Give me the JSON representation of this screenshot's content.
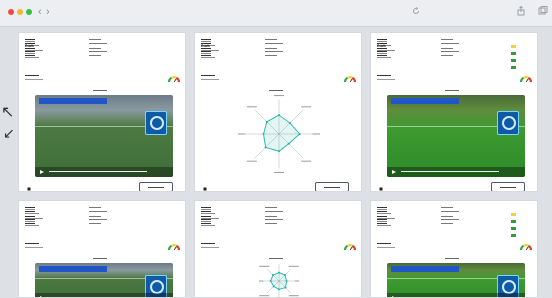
{
  "window": {
    "traffic_lights": [
      "#ef4a3e",
      "#f2b634",
      "#30c244"
    ],
    "nav_back_glyph": "‹",
    "nav_forward_glyph": "›",
    "icons": [
      "refresh-icon",
      "share-icon",
      "new-tab-icon"
    ]
  },
  "annotation": {
    "arrow_up_glyph": "↖",
    "arrow_down_glyph": "↙"
  },
  "cards": [
    {
      "variant": "video",
      "player_name": "Eswik",
      "pitch": "grass-dark",
      "show_player_icon": true
    },
    {
      "variant": "radar",
      "player_name": "Eswik"
    },
    {
      "variant": "video",
      "player_name": "Eswik",
      "pitch": "grass-bright",
      "show_player_icon": true,
      "bars": true
    },
    {
      "variant": "video",
      "player_name": "",
      "pitch": "grass-dark"
    },
    {
      "variant": "radar",
      "player_name": ""
    },
    {
      "variant": "video",
      "player_name": "",
      "pitch": "grass-bright",
      "bars": true
    }
  ],
  "colors": {
    "gauge": [
      "#3aa64b",
      "#f5d22f",
      "#e03b2b"
    ],
    "radar_line": "#1fb3a6",
    "radar_axis": "#9aa0a6",
    "bars": [
      "#f3d04a",
      "#3a9a3f"
    ],
    "video_title": "#2156c9"
  },
  "radar_data": {
    "first": [
      0.55,
      0.45,
      0.6,
      0.4,
      0.5,
      0.55,
      0.45,
      0.5
    ],
    "second": [
      0.5,
      0.5,
      0.45,
      0.55,
      0.5,
      0.45,
      0.5,
      0.5
    ]
  }
}
